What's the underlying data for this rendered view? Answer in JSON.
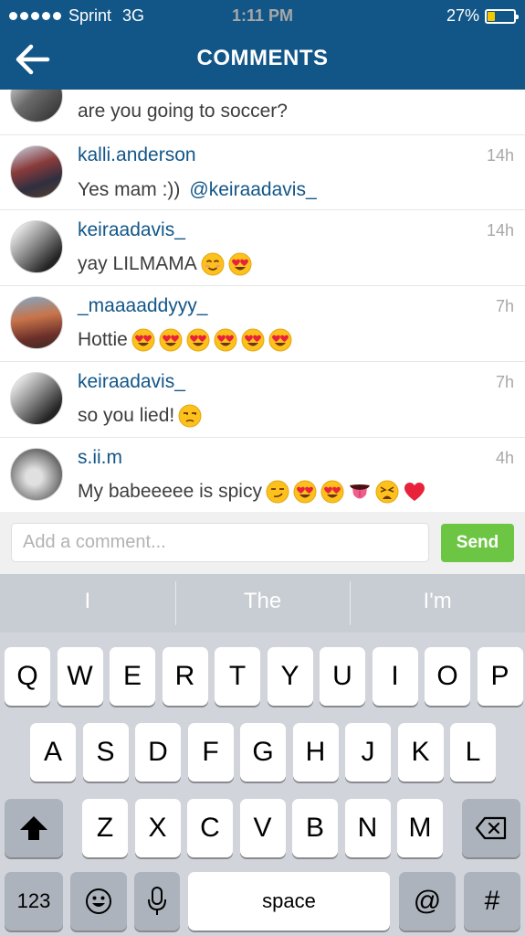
{
  "status": {
    "carrier": "Sprint",
    "network": "3G",
    "time": "1:11 PM",
    "battery": "27%",
    "battery_level": 0.27
  },
  "nav": {
    "title": "COMMENTS"
  },
  "comments": [
    {
      "user": "",
      "time": "",
      "text": "are you going to soccer?",
      "mention": "",
      "emojis": []
    },
    {
      "user": "kalli.anderson",
      "time": "14h",
      "text": "Yes mam :))",
      "mention": "@keiraadavis_",
      "emojis": []
    },
    {
      "user": "keiraadavis_",
      "time": "14h",
      "text": "yay LILMAMA",
      "mention": "",
      "emojis": [
        "smiling-face-icon",
        "heart-eyes-icon"
      ]
    },
    {
      "user": "_maaaaddyyy_",
      "time": "7h",
      "text": "Hottie",
      "mention": "",
      "emojis": [
        "heart-eyes-icon",
        "heart-eyes-icon",
        "heart-eyes-icon",
        "heart-eyes-icon",
        "heart-eyes-icon",
        "heart-eyes-icon"
      ]
    },
    {
      "user": "keiraadavis_",
      "time": "7h",
      "text": "so you lied!",
      "mention": "",
      "emojis": [
        "unamused-face-icon"
      ]
    },
    {
      "user": "s.ii.m",
      "time": "4h",
      "text": "My babeeeee is spicy",
      "mention": "",
      "emojis": [
        "smirk-face-icon",
        "heart-eyes-icon",
        "heart-eyes-icon",
        "tongue-icon",
        "weary-face-icon",
        "red-heart-icon"
      ]
    }
  ],
  "input": {
    "placeholder": "Add a comment...",
    "value": ""
  },
  "send_label": "Send",
  "keyboard": {
    "suggestions": [
      "I",
      "The",
      "I'm"
    ],
    "row1": [
      "Q",
      "W",
      "E",
      "R",
      "T",
      "Y",
      "U",
      "I",
      "O",
      "P"
    ],
    "row2": [
      "A",
      "S",
      "D",
      "F",
      "G",
      "H",
      "J",
      "K",
      "L"
    ],
    "row3": [
      "Z",
      "X",
      "C",
      "V",
      "B",
      "N",
      "M"
    ],
    "numbers_key": "123",
    "space_key": "space",
    "at_key": "@",
    "hash_key": "#"
  }
}
